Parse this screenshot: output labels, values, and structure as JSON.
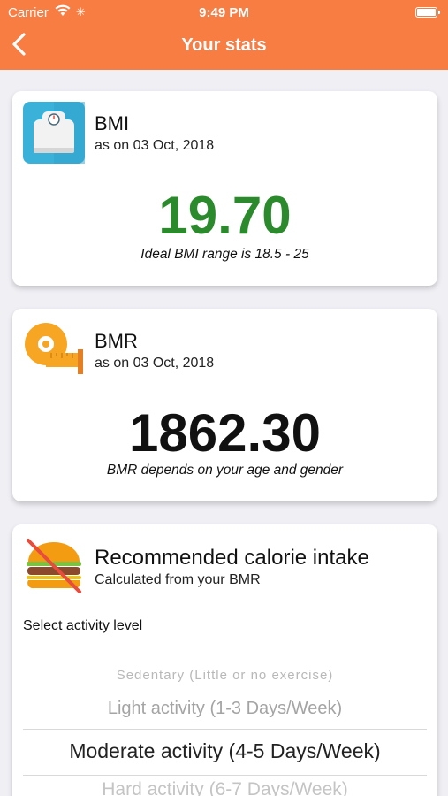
{
  "status": {
    "carrier": "Carrier",
    "time": "9:49 PM"
  },
  "nav": {
    "title": "Your stats"
  },
  "bmi": {
    "title": "BMI",
    "date": "as on 03 Oct, 2018",
    "value": "19.70",
    "note": "Ideal BMI range is 18.5 - 25",
    "icon": "scale-icon"
  },
  "bmr": {
    "title": "BMR",
    "date": "as on 03 Oct, 2018",
    "value": "1862.30",
    "note": "BMR depends on your age and gender",
    "icon": "tape-measure-icon"
  },
  "calories": {
    "title": "Recommended calorie intake",
    "subtitle": "Calculated from your BMR",
    "select_label": "Select activity level",
    "icon": "no-burger-icon",
    "options": [
      "Sedentary (Little or no exercise)",
      "Light activity (1-3 Days/Week)",
      "Moderate activity (4-5 Days/Week)",
      "Hard activity (6-7 Days/Week)"
    ],
    "selected": "Moderate activity (4-5 Days/Week)"
  },
  "colors": {
    "accent": "#f77d43",
    "bmi_value": "#2b8a2b",
    "background": "#efeff4"
  }
}
